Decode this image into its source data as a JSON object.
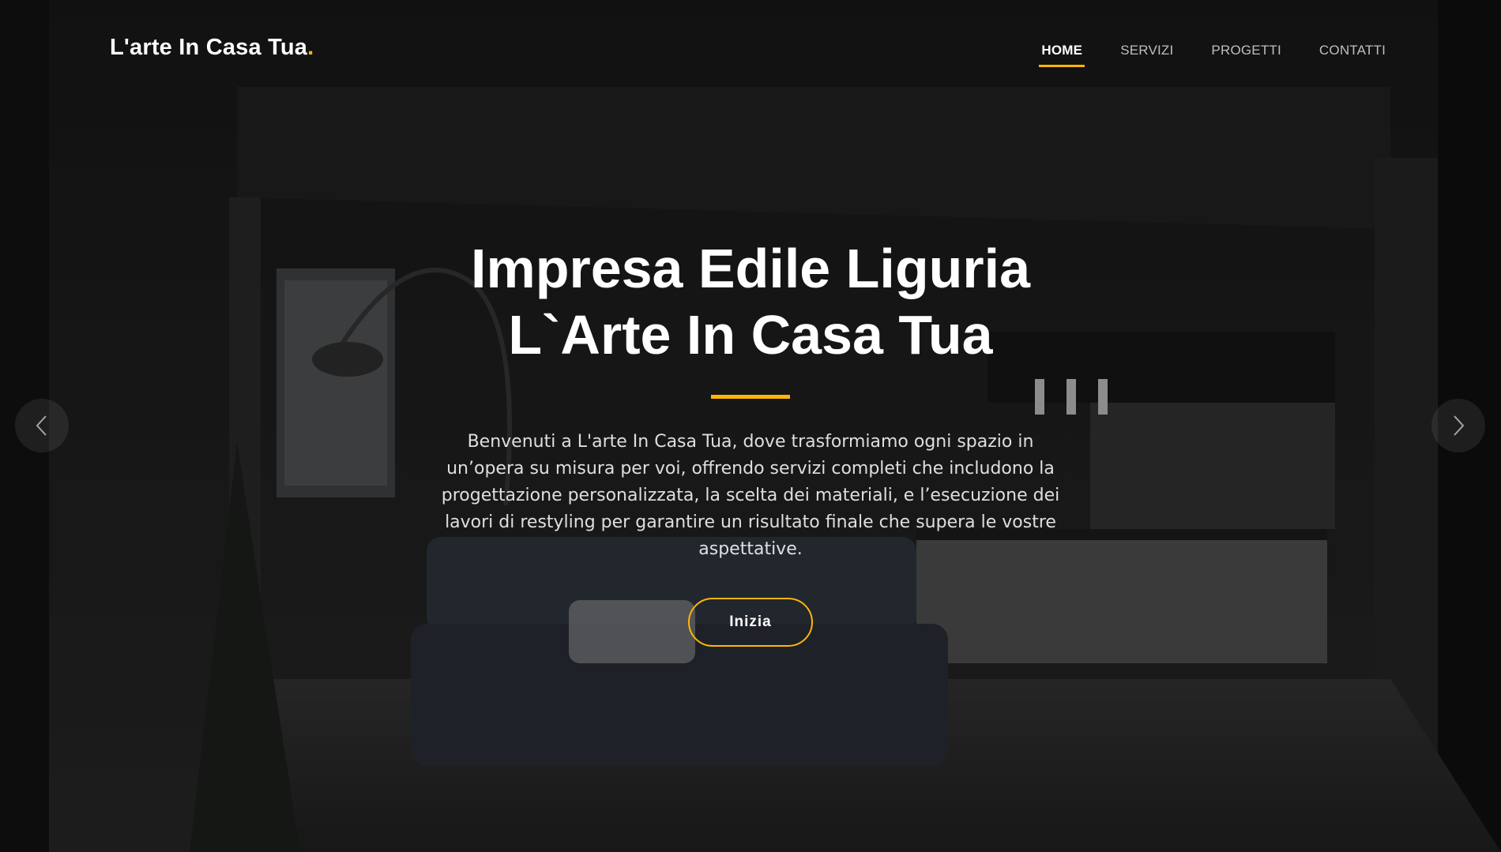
{
  "header": {
    "logo_text": "L'arte In Casa Tua",
    "logo_dot": ".",
    "nav": [
      {
        "label": "HOME",
        "active": true
      },
      {
        "label": "SERVIZI",
        "active": false
      },
      {
        "label": "PROGETTI",
        "active": false
      },
      {
        "label": "CONTATTI",
        "active": false
      }
    ]
  },
  "hero": {
    "title_line1": "Impresa Edile Liguria",
    "title_line2": "L`Arte In Casa Tua",
    "description": "Benvenuti a L'arte In Casa Tua, dove trasformiamo ogni spazio in un’opera su misura per voi, offrendo servizi completi che includono la progettazione personalizzata, la scelta dei materiali, e l’esecuzione dei lavori di restyling per garantire un risultato finale che supera le vostre aspettative.",
    "cta_label": "Inizia"
  },
  "carousel": {
    "prev_icon": "chevron-left-icon",
    "next_icon": "chevron-right-icon"
  },
  "colors": {
    "accent": "#ffb606",
    "background": "#1a1a1a"
  }
}
